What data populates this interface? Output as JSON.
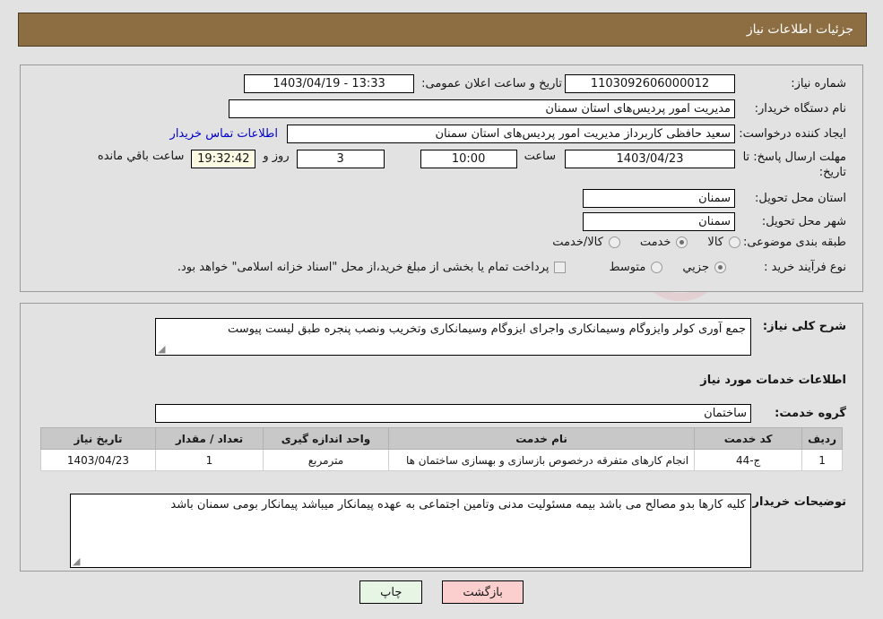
{
  "header": {
    "title": "جزئیات اطلاعات نیاز"
  },
  "colors": {
    "header_bg": "#8d6e43",
    "page_bg": "#e2e2e2",
    "link": "#0000cc",
    "table_header_bg": "#c8c8c8",
    "countdown_bg": "#fbfbe4",
    "print_btn_bg": "#e6f5e4",
    "back_btn_bg": "#fbcfce"
  },
  "watermark": {
    "text": "AriaTender.net"
  },
  "form": {
    "need_number_label": "شماره نیاز:",
    "need_number_value": "1103092606000012",
    "announce_datetime_label": "تاریخ و ساعت اعلان عمومی:",
    "announce_datetime_value": "13:33 - 1403/04/19",
    "buyer_org_label": "نام دستگاه خریدار:",
    "buyer_org_value": "مدیریت امور پردیس‌های استان سمنان",
    "creator_label": "ایجاد کننده درخواست:",
    "creator_value": "سعید حافظی کاربرداز مدیریت امور پردیس‌های استان سمنان",
    "contact_link": "اطلاعات تماس خریدار",
    "deadline_label": "مهلت ارسال پاسخ: تا تاریخ:",
    "deadline_date": "1403/04/23",
    "deadline_time_label": "ساعت",
    "deadline_time": "10:00",
    "remaining_days": "3",
    "remaining_days_unit": "روز و",
    "remaining_clock": "19:32:42",
    "remaining_suffix": "ساعت باقي مانده",
    "delivery_province_label": "استان محل تحویل:",
    "delivery_province_value": "سمنان",
    "delivery_city_label": "شهر محل تحویل:",
    "delivery_city_value": "سمنان",
    "category_label": "طبقه بندی موضوعی:",
    "category_options": [
      {
        "label": "کالا",
        "selected": false
      },
      {
        "label": "خدمت",
        "selected": true
      },
      {
        "label": "کالا/خدمت",
        "selected": false
      }
    ],
    "process_type_label": "نوع فرآیند خرید :",
    "process_type_options": [
      {
        "label": "جزیي",
        "selected": true
      },
      {
        "label": "متوسط",
        "selected": false
      }
    ],
    "treasury_checkbox_checked": false,
    "treasury_note": "پرداخت تمام یا بخشی از مبلغ خرید،از محل \"اسناد خزانه اسلامی\" خواهد بود."
  },
  "need_description": {
    "label": "شرح کلی نیاز:",
    "value": "جمع آوری کولر وایزوگام وسیمانکاری واجرای ایزوگام وسیمانکاری وتخریب ونصب پنجره طبق لیست پیوست"
  },
  "services_section": {
    "title": "اطلاعات خدمات مورد نیاز",
    "service_group_label": "گروه خدمت:",
    "service_group_value": "ساختمان"
  },
  "items_table": {
    "columns": [
      "ردیف",
      "کد خدمت",
      "نام خدمت",
      "واحد اندازه گیری",
      "تعداد / مقدار",
      "تاریخ نیاز"
    ],
    "rows": [
      {
        "row": "1",
        "code": "ج-44",
        "name": "انجام کارهای متفرقه درخصوص بازسازی و بهسازی ساختمان ها",
        "unit": "مترمربع",
        "qty": "1",
        "need_date": "1403/04/23"
      }
    ]
  },
  "buyer_notes": {
    "label": "توضیحات خریدار:",
    "value": "کلیه کارها بدو مصالح می باشد  بیمه مسئولیت مدنی وتامین اجتماعی به عهده پیمانکار میباشد پیمانکار بومی سمنان باشد"
  },
  "buttons": {
    "print": "چاپ",
    "back": "بازگشت"
  }
}
